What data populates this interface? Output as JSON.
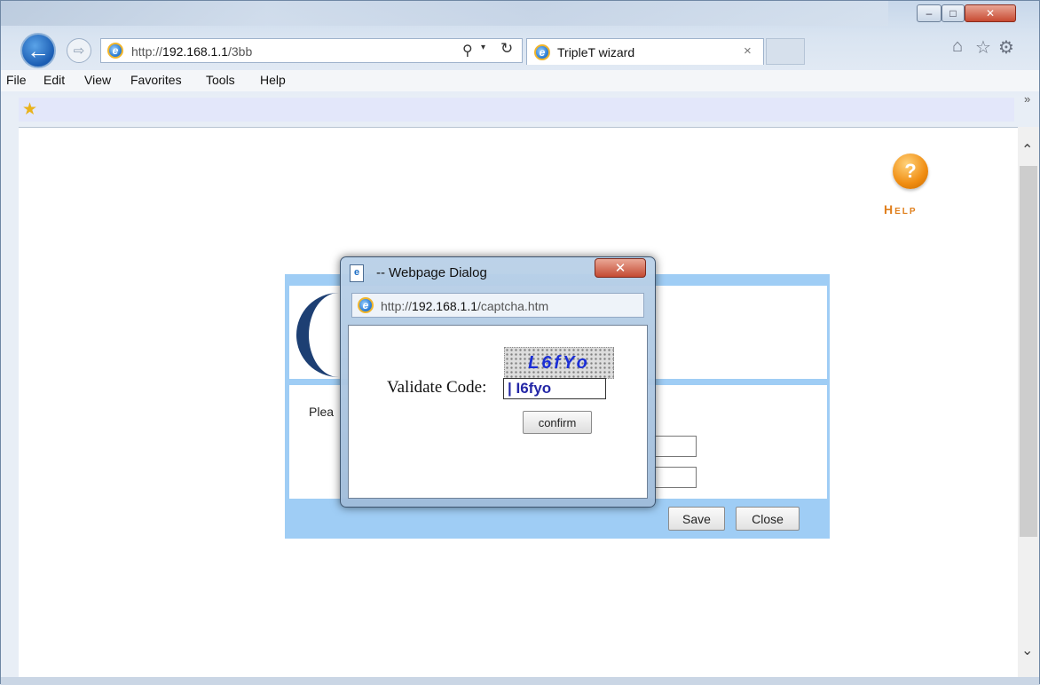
{
  "browser": {
    "address": {
      "prefix": "http://",
      "host": "192.168.1.1",
      "path": "/3bb"
    },
    "tab": {
      "title": "TripleT wizard",
      "close": "×"
    },
    "nav": {
      "back": "←",
      "forward": "⇨",
      "search": "⚲",
      "dropdown": "▾",
      "refresh": "↻"
    },
    "icons": {
      "home": "⌂",
      "favorites": "☆",
      "tools": "⚙",
      "ie": "e"
    },
    "window_controls": {
      "minimize": "–",
      "maximize": "□",
      "close": "✕"
    },
    "menu": [
      "File",
      "Edit",
      "View",
      "Favorites",
      "Tools",
      "Help"
    ],
    "favorites_bar": {
      "star": "★",
      "chevron": "»"
    }
  },
  "page": {
    "help_label": "Help",
    "help_glyph": "?",
    "wizard": {
      "partial_text": "Plea",
      "save_label": "Save",
      "close_label": "Close"
    },
    "scroll": {
      "up": "⌃",
      "down": "⌄"
    }
  },
  "dialog": {
    "title": "-- Webpage Dialog",
    "close": "✕",
    "url": {
      "prefix": "http://",
      "host": "192.168.1.1",
      "path": "/captcha.htm"
    },
    "captcha_text": "L6fYo",
    "validate_label": "Validate Code:",
    "input_value": "| I6fyo",
    "confirm_label": "confirm"
  },
  "colors": {
    "wizard_frame": "#9fcdf5",
    "help_orange": "#f08d12",
    "captcha_text": "#1b2ed6"
  }
}
